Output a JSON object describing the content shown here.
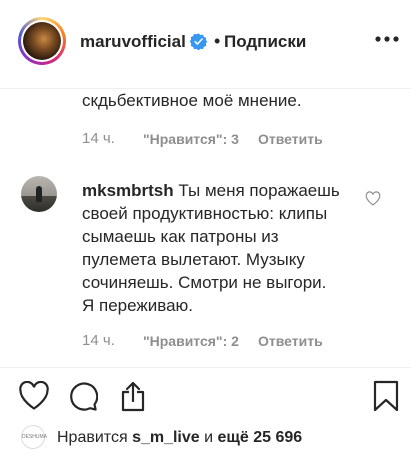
{
  "header": {
    "username": "maruvofficial",
    "separator": "•",
    "follow_label": "Подписки"
  },
  "comments": [
    {
      "text": "скдьбективное моё мнение.",
      "time": "14 ч.",
      "likes": "\"Нравится\": 3",
      "reply": "Ответить"
    },
    {
      "username": "mksmbrtsh",
      "text_lines": [
        "Ты меня поражаешь",
        "своей продуктивностью: клипы",
        "сымаешь как патроны из",
        "пулемета вылетают. Музыку",
        "сочиняешь. Смотри не выгори.",
        "Я переживаю."
      ],
      "time": "14 ч.",
      "likes": "\"Нравится\": 2",
      "reply": "Ответить"
    }
  ],
  "likes_summary": {
    "avatar_text": "DESHUMA",
    "prefix": "Нравится",
    "user": "s_m_live",
    "middle": "и",
    "count": "ещё 25 696"
  },
  "icons": {
    "verified": "verified-badge-icon",
    "more": "more-options-icon",
    "comment_like": "heart-outline-icon",
    "like": "heart-outline-icon",
    "comment": "comment-bubble-icon",
    "share": "share-icon",
    "save": "bookmark-icon"
  },
  "colors": {
    "verified": "#3897f0",
    "muted": "#8e8e8e",
    "text": "#262626"
  }
}
